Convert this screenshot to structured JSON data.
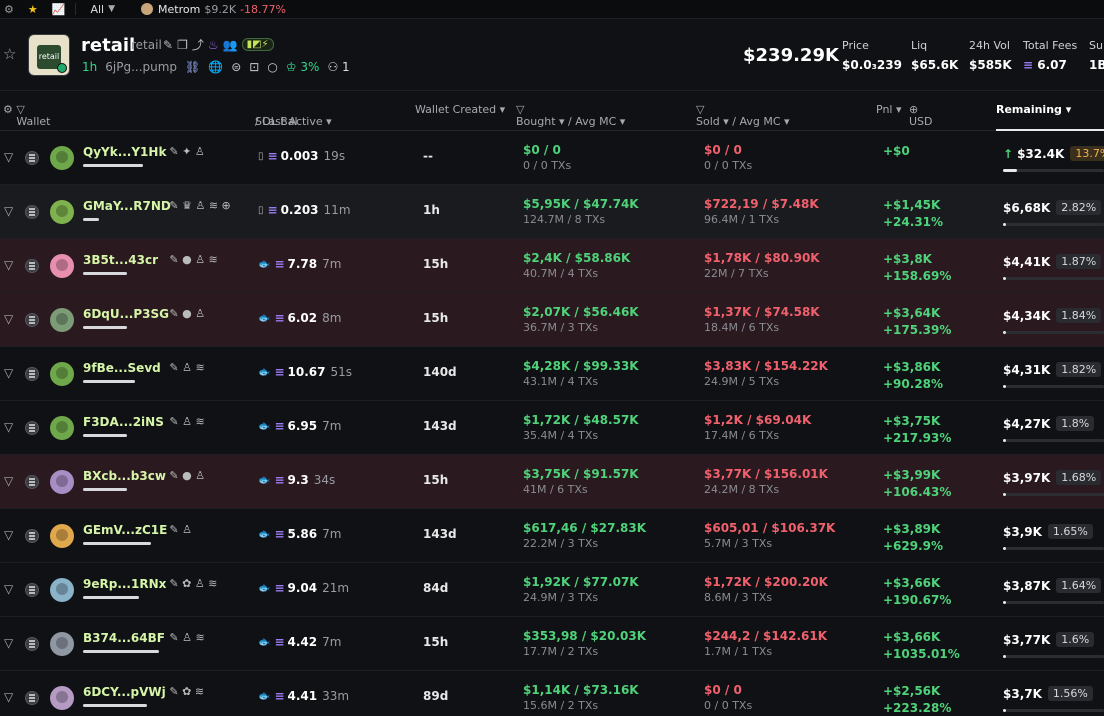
{
  "topbar": {
    "all_label": "All",
    "token_name": "Metrom",
    "token_mc": "$9.2K",
    "token_change": "-18.77%"
  },
  "token": {
    "name": "retail",
    "symbol": "retail",
    "age": "1h",
    "address": "6jPg...pump",
    "pill_text": "▮◩⚡",
    "holders_pct": "3%",
    "count": "1",
    "market_cap": "$239.29K"
  },
  "stats": [
    {
      "label": "Price",
      "value": "$0.0₃239"
    },
    {
      "label": "Liq",
      "value": "$65.6K"
    },
    {
      "label": "24h Vol",
      "value": "$585K"
    },
    {
      "label": "Total Fees",
      "value": "6.07"
    },
    {
      "label": "Sup",
      "value": "1B"
    }
  ],
  "columns": {
    "wallet": "Wallet",
    "sol_bal": "SOL Bal",
    "last_active": "/ Last Active ▾",
    "wallet_created": "Wallet Created ▾",
    "bought": "Bought ▾ / Avg MC ▾",
    "sold": "Sold ▾ / Avg MC ▾",
    "pnl": "Pnl ▾",
    "usd": "USD",
    "remaining": "Remaining ▾"
  },
  "colors": {
    "buy": "#4fd27a",
    "sell": "#f0616d",
    "sol": "#9b7cf5"
  },
  "rows": [
    {
      "wallet": "QyYk...Y1Hk",
      "icon_text": "✎ ✦ ♙",
      "sol": "0.003",
      "last": "19s",
      "created": "--",
      "bought": "$0 / 0",
      "bought_sub": "0 / 0 TXs",
      "sold": "$0 / 0",
      "sold_sub": "0 / 0 TXs",
      "pnl1": "+$0",
      "pnl2": "",
      "remaining": "$32.4K",
      "pct": "13.7%",
      "remaining_fraction": 0.137,
      "wallet_bar_fraction": 0.75,
      "kind": "wallet",
      "arrow": "↑"
    },
    {
      "wallet": "GMaY...R7ND",
      "icon_text": "✎ ♛ ♙ ≋ ⊕",
      "sol": "0.203",
      "last": "11m",
      "created": "1h",
      "bought": "$5,95K / $47.74K",
      "bought_sub": "124.7M / 8 TXs",
      "sold": "$722,19 / $7.48K",
      "sold_sub": "96.4M / 1 TXs",
      "pnl1": "+$1,45K",
      "pnl2": "+24.31%",
      "remaining": "$6,68K",
      "pct": "2.82%",
      "remaining_fraction": 0.028,
      "wallet_bar_fraction": 0.2,
      "kind": "wallet",
      "arrow": ""
    },
    {
      "wallet": "3B5t...43cr",
      "icon_text": "✎ ● ♙ ≋",
      "sol": "7.78",
      "last": "7m",
      "created": "15h",
      "bought": "$2,4K / $58.86K",
      "bought_sub": "40.7M / 4 TXs",
      "sold": "$1,78K / $80.90K",
      "sold_sub": "22M / 7 TXs",
      "pnl1": "+$3,8K",
      "pnl2": "+158.69%",
      "remaining": "$4,41K",
      "pct": "1.87%",
      "remaining_fraction": 0.019,
      "wallet_bar_fraction": 0.55,
      "kind": "fish",
      "arrow": ""
    },
    {
      "wallet": "6DqU...P3SG",
      "icon_text": "✎ ● ♙",
      "sol": "6.02",
      "last": "8m",
      "created": "15h",
      "bought": "$2,07K / $56.46K",
      "bought_sub": "36.7M / 3 TXs",
      "sold": "$1,37K / $74.58K",
      "sold_sub": "18.4M / 6 TXs",
      "pnl1": "+$3,64K",
      "pnl2": "+175.39%",
      "remaining": "$4,34K",
      "pct": "1.84%",
      "remaining_fraction": 0.018,
      "wallet_bar_fraction": 0.55,
      "kind": "fish",
      "arrow": ""
    },
    {
      "wallet": "9fBe...Sevd",
      "icon_text": "✎ ♙ ≋",
      "sol": "10.67",
      "last": "51s",
      "created": "140d",
      "bought": "$4,28K / $99.33K",
      "bought_sub": "43.1M / 4 TXs",
      "sold": "$3,83K / $154.22K",
      "sold_sub": "24.9M / 5 TXs",
      "pnl1": "+$3,86K",
      "pnl2": "+90.28%",
      "remaining": "$4,31K",
      "pct": "1.82%",
      "remaining_fraction": 0.018,
      "wallet_bar_fraction": 0.65,
      "kind": "fish",
      "arrow": ""
    },
    {
      "wallet": "F3DA...2iNS",
      "icon_text": "✎ ♙ ≋",
      "sol": "6.95",
      "last": "7m",
      "created": "143d",
      "bought": "$1,72K / $48.57K",
      "bought_sub": "35.4M / 4 TXs",
      "sold": "$1,2K / $69.04K",
      "sold_sub": "17.4M / 6 TXs",
      "pnl1": "+$3,75K",
      "pnl2": "+217.93%",
      "remaining": "$4,27K",
      "pct": "1.8%",
      "remaining_fraction": 0.018,
      "wallet_bar_fraction": 0.55,
      "kind": "fish",
      "arrow": ""
    },
    {
      "wallet": "BXcb...b3cw",
      "icon_text": "✎ ● ♙",
      "sol": "9.3",
      "last": "34s",
      "created": "15h",
      "bought": "$3,75K / $91.57K",
      "bought_sub": "41M / 6 TXs",
      "sold": "$3,77K / $156.01K",
      "sold_sub": "24.2M / 8 TXs",
      "pnl1": "+$3,99K",
      "pnl2": "+106.43%",
      "remaining": "$3,97K",
      "pct": "1.68%",
      "remaining_fraction": 0.017,
      "wallet_bar_fraction": 0.55,
      "kind": "fish",
      "arrow": ""
    },
    {
      "wallet": "GEmV...zC1E",
      "icon_text": "✎ ♙",
      "sol": "5.86",
      "last": "7m",
      "created": "143d",
      "bought": "$617,46 / $27.83K",
      "bought_sub": "22.2M / 3 TXs",
      "sold": "$605,01 / $106.37K",
      "sold_sub": "5.7M / 3 TXs",
      "pnl1": "+$3,89K",
      "pnl2": "+629.9%",
      "remaining": "$3,9K",
      "pct": "1.65%",
      "remaining_fraction": 0.016,
      "wallet_bar_fraction": 0.85,
      "kind": "fish",
      "arrow": ""
    },
    {
      "wallet": "9eRp...1RNx",
      "icon_text": "✎ ✿ ♙ ≋",
      "sol": "9.04",
      "last": "21m",
      "created": "84d",
      "bought": "$1,92K / $77.07K",
      "bought_sub": "24.9M / 3 TXs",
      "sold": "$1,72K / $200.20K",
      "sold_sub": "8.6M / 3 TXs",
      "pnl1": "+$3,66K",
      "pnl2": "+190.67%",
      "remaining": "$3,87K",
      "pct": "1.64%",
      "remaining_fraction": 0.016,
      "wallet_bar_fraction": 0.7,
      "kind": "fish",
      "arrow": ""
    },
    {
      "wallet": "B374...64BF",
      "icon_text": "✎ ♙ ≋",
      "sol": "4.42",
      "last": "7m",
      "created": "15h",
      "bought": "$353,98 / $20.03K",
      "bought_sub": "17.7M / 2 TXs",
      "sold": "$244,2 / $142.61K",
      "sold_sub": "1.7M / 1 TXs",
      "pnl1": "+$3,66K",
      "pnl2": "+1035.01%",
      "remaining": "$3,77K",
      "pct": "1.6%",
      "remaining_fraction": 0.016,
      "wallet_bar_fraction": 0.95,
      "kind": "fish",
      "arrow": ""
    },
    {
      "wallet": "6DCY...pVWj",
      "icon_text": "✎ ✿ ≋",
      "sol": "4.41",
      "last": "33m",
      "created": "89d",
      "bought": "$1,14K / $73.16K",
      "bought_sub": "15.6M / 2 TXs",
      "sold": "$0 / 0",
      "sold_sub": "0 / 0 TXs",
      "pnl1": "+$2,56K",
      "pnl2": "+223.28%",
      "remaining": "$3,7K",
      "pct": "1.56%",
      "remaining_fraction": 0.016,
      "wallet_bar_fraction": 0.8,
      "kind": "fish",
      "arrow": ""
    }
  ]
}
